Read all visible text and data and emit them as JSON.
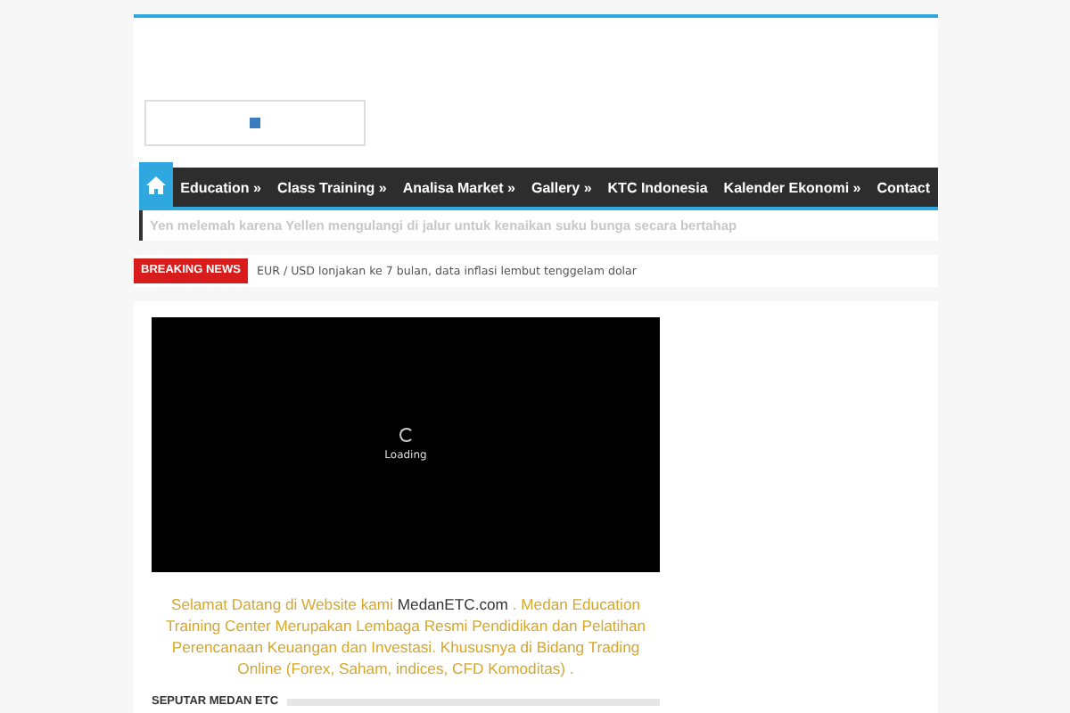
{
  "nav": {
    "items": [
      {
        "label": "Education »",
        "selected": false
      },
      {
        "label": "Class Training »",
        "selected": false
      },
      {
        "label": "Analisa Market »",
        "selected": false
      },
      {
        "label": "Gallery »",
        "selected": false
      },
      {
        "label": "KTC Indonesia",
        "selected": false
      },
      {
        "label": "Kalender Ekonomi »",
        "selected": false
      },
      {
        "label": "Contact",
        "selected": false
      }
    ],
    "home_selected": true
  },
  "ticker": "Yen melemah karena Yellen mengulangi di jalur untuk kenaikan suku bunga secara bertahap",
  "breaking": {
    "label": "BREAKING NEWS",
    "text": "EUR / USD lonjakan ke 7 bulan, data inflasi lembut tenggelam dolar"
  },
  "video": {
    "status": "Loading"
  },
  "intro": {
    "before": "Selamat Datang di Website kami",
    "link": "MedanETC.com",
    "after": ". Medan Education Training Center Merupakan Lembaga Resmi Pendidikan dan Pelatihan Perencanaan Keuangan dan Investasi. Khususnya di Bidang Trading Online (Forex, Saham, indices, CFD Komoditas) ."
  },
  "section_title": "SEPUTAR MEDAN ETC"
}
